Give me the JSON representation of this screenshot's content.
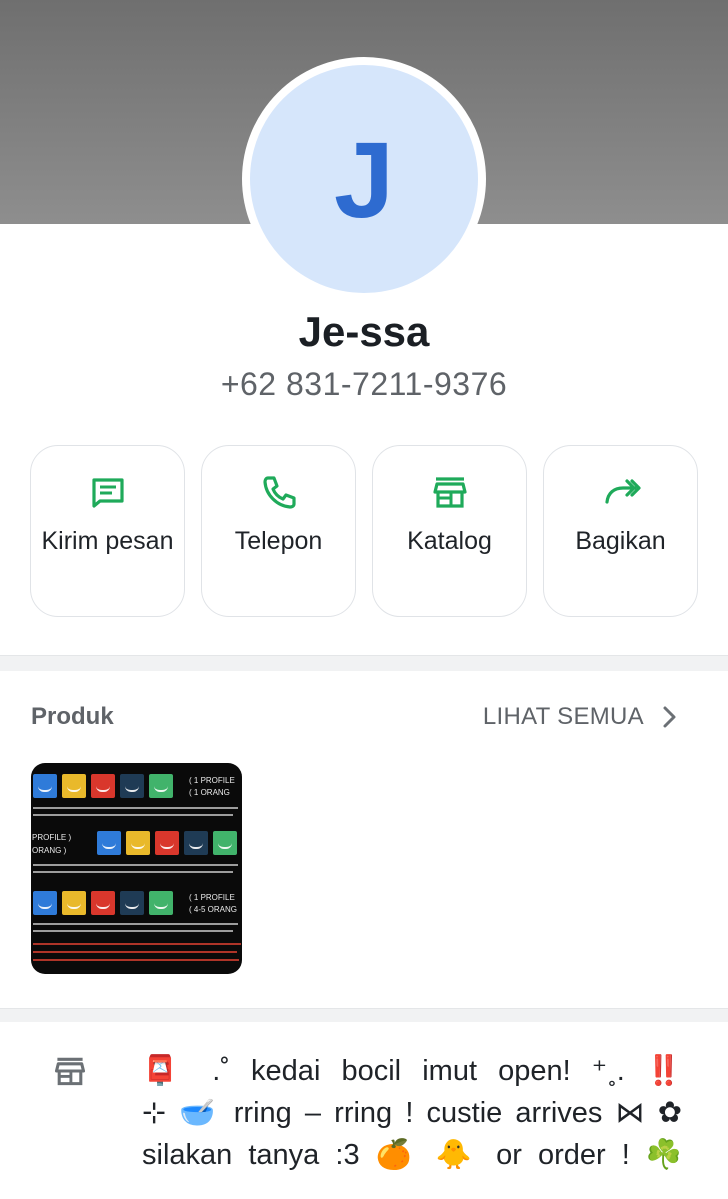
{
  "contact": {
    "initial": "J",
    "name": "Je-ssa",
    "phone": "+62 831-7211-9376"
  },
  "colors": {
    "accent_green": "#1faa5a",
    "avatar_bg": "#d6e6fb",
    "avatar_letter": "#2e6bd0",
    "thumb_blue": "#2f7bd9",
    "thumb_yellow": "#e9b92b",
    "thumb_red": "#d9372c",
    "thumb_navy": "#1f3b55",
    "thumb_green": "#41b36b"
  },
  "actions": [
    {
      "label": "Kirim pesan",
      "icon": "message-icon"
    },
    {
      "label": "Telepon",
      "icon": "phone-icon"
    },
    {
      "label": "Katalog",
      "icon": "store-icon"
    },
    {
      "label": "Bagikan",
      "icon": "share-forward-icon"
    }
  ],
  "products": {
    "title": "Produk",
    "see_all": "LIHAT SEMUA",
    "thumbnail": {
      "row1_label_a": "1 PROFILE",
      "row1_label_b": "1 ORANG",
      "row2_label_a": "PROFILE",
      "row2_label_b": "ORANG",
      "row3_label_a": "1 PROFILE",
      "row3_label_b": "4-5 ORANG"
    }
  },
  "about": {
    "icon": "store-icon",
    "lines": [
      "📮 .˚ kedai bocil imut open! ⁺˳. ‼️",
      "⊹ 🥣 rring – rring ! custie arrives ⋈ ✿",
      "silakan tanya :3 🍊 🐥 or order ! ☘️"
    ]
  }
}
